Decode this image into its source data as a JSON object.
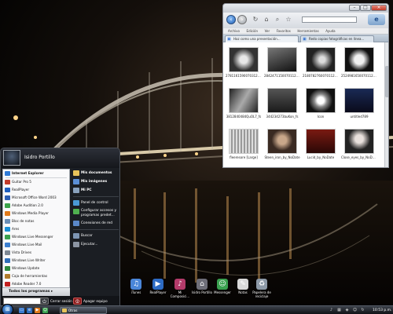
{
  "explorer": {
    "menubar": [
      "Archivo",
      "Edición",
      "Ver",
      "Favoritos",
      "Herramientas",
      "Ayuda"
    ],
    "tabs": [
      {
        "label": "Haz como una presentación..."
      },
      {
        "label": "Redo copias fotográficas en línea..."
      }
    ],
    "thumbnails": [
      {
        "caption": "2781161590070312867..."
      },
      {
        "caption": "2842471150070112867..."
      },
      {
        "caption": "2180782760070112867..."
      },
      {
        "caption": "2524981650070112867..."
      },
      {
        "caption": "3812840484QuOL7_fs"
      },
      {
        "caption": "344234273buKon_fs"
      },
      {
        "caption": "Icon"
      },
      {
        "caption": "untitled789"
      },
      {
        "caption": "fleeresore [Large]"
      },
      {
        "caption": "Steen_iron_by_NoDate"
      },
      {
        "caption": "Lucid_by_NoDate"
      },
      {
        "caption": "Close_eyes_by_NoDate"
      }
    ]
  },
  "start_menu": {
    "user": "Isidro Portillo",
    "left_items": [
      {
        "label": "Internet Explorer",
        "pinned": true,
        "icon": "ie-icon",
        "color": "#2f7ad6"
      },
      {
        "label": "Guitar Pro 5",
        "icon": "guitar-icon",
        "color": "#c23b2a"
      },
      {
        "label": "RealPlayer",
        "icon": "realplayer-icon",
        "color": "#1f5fbf"
      },
      {
        "label": "Microsoft Office Word 2003",
        "icon": "word-icon",
        "color": "#2d5fb4"
      },
      {
        "label": "Adobe Audition 2.0",
        "icon": "audition-icon",
        "color": "#3aa34a"
      },
      {
        "label": "Windows Media Player",
        "icon": "media-player-icon",
        "color": "#e07a1a"
      },
      {
        "label": "Bloc de notas",
        "icon": "notepad-icon",
        "color": "#6b8fb8"
      },
      {
        "label": "Ares",
        "icon": "ares-icon",
        "color": "#1a8fd6"
      },
      {
        "label": "Windows Live Messenger",
        "icon": "messenger-icon",
        "color": "#3aa14f"
      },
      {
        "label": "Windows Live Mail",
        "icon": "mail-icon",
        "color": "#3b7fd0"
      },
      {
        "label": "Vista Drives",
        "icon": "drive-icon",
        "color": "#7d8894"
      },
      {
        "label": "Windows Live Writer",
        "icon": "writer-icon",
        "color": "#2f6fb9"
      },
      {
        "label": "Windows Update",
        "icon": "update-icon",
        "color": "#2d8a3e"
      },
      {
        "label": "Caja de herramientas",
        "icon": "toolbox-icon",
        "color": "#b07b2b"
      },
      {
        "label": "Adobe Reader 7.0",
        "icon": "reader-icon",
        "color": "#c22020"
      }
    ],
    "all_programs": "Todos los programas",
    "right_items": [
      {
        "label": "Mis documentos",
        "bold": true,
        "icon": "folder-icon",
        "color": "#e6c25a"
      },
      {
        "label": "Mis imágenes",
        "bold": true,
        "icon": "pictures-icon",
        "color": "#5b8fd6"
      },
      {
        "label": "Mi PC",
        "bold": true,
        "icon": "computer-icon",
        "color": "#8aa2bd"
      },
      {
        "label": "Panel de control",
        "icon": "control-panel-icon",
        "color": "#4a9ad6"
      },
      {
        "label": "Configurar accesos y programas predet...",
        "icon": "defaults-icon",
        "color": "#4fb04f"
      },
      {
        "label": "Conexiones de red",
        "icon": "network-icon",
        "color": "#5a88c9"
      },
      {
        "label": "Buscar",
        "icon": "search-icon",
        "color": "#7e96b4"
      },
      {
        "label": "Ejecutar...",
        "icon": "run-icon",
        "color": "#8c95a3"
      }
    ],
    "shutdown_label": "Cerrar sesión",
    "lock_label": "Apagar equipo"
  },
  "desktop_icons": [
    {
      "label": "iTunes",
      "icon": "itunes-icon",
      "color": "#4a86d9"
    },
    {
      "label": "RealPlayer",
      "icon": "realplayer-icon",
      "color": "#2d6bc4"
    },
    {
      "label": "Mi Composici...",
      "icon": "composition-icon",
      "color": "#b33b6a"
    },
    {
      "label": "Isidro Portillo",
      "icon": "user-folder-icon",
      "color": "#6e6e78"
    },
    {
      "label": "Messenger",
      "icon": "messenger-icon",
      "color": "#3aa14f"
    },
    {
      "label": "Notas",
      "icon": "notes-icon",
      "color": "#d9d9d9"
    },
    {
      "label": "Papelera de reciclaje",
      "icon": "recycle-bin-icon",
      "color": "#8e9aa8"
    }
  ],
  "taskbar": {
    "window_button": "Otras",
    "clock": "10:53 p.m."
  }
}
